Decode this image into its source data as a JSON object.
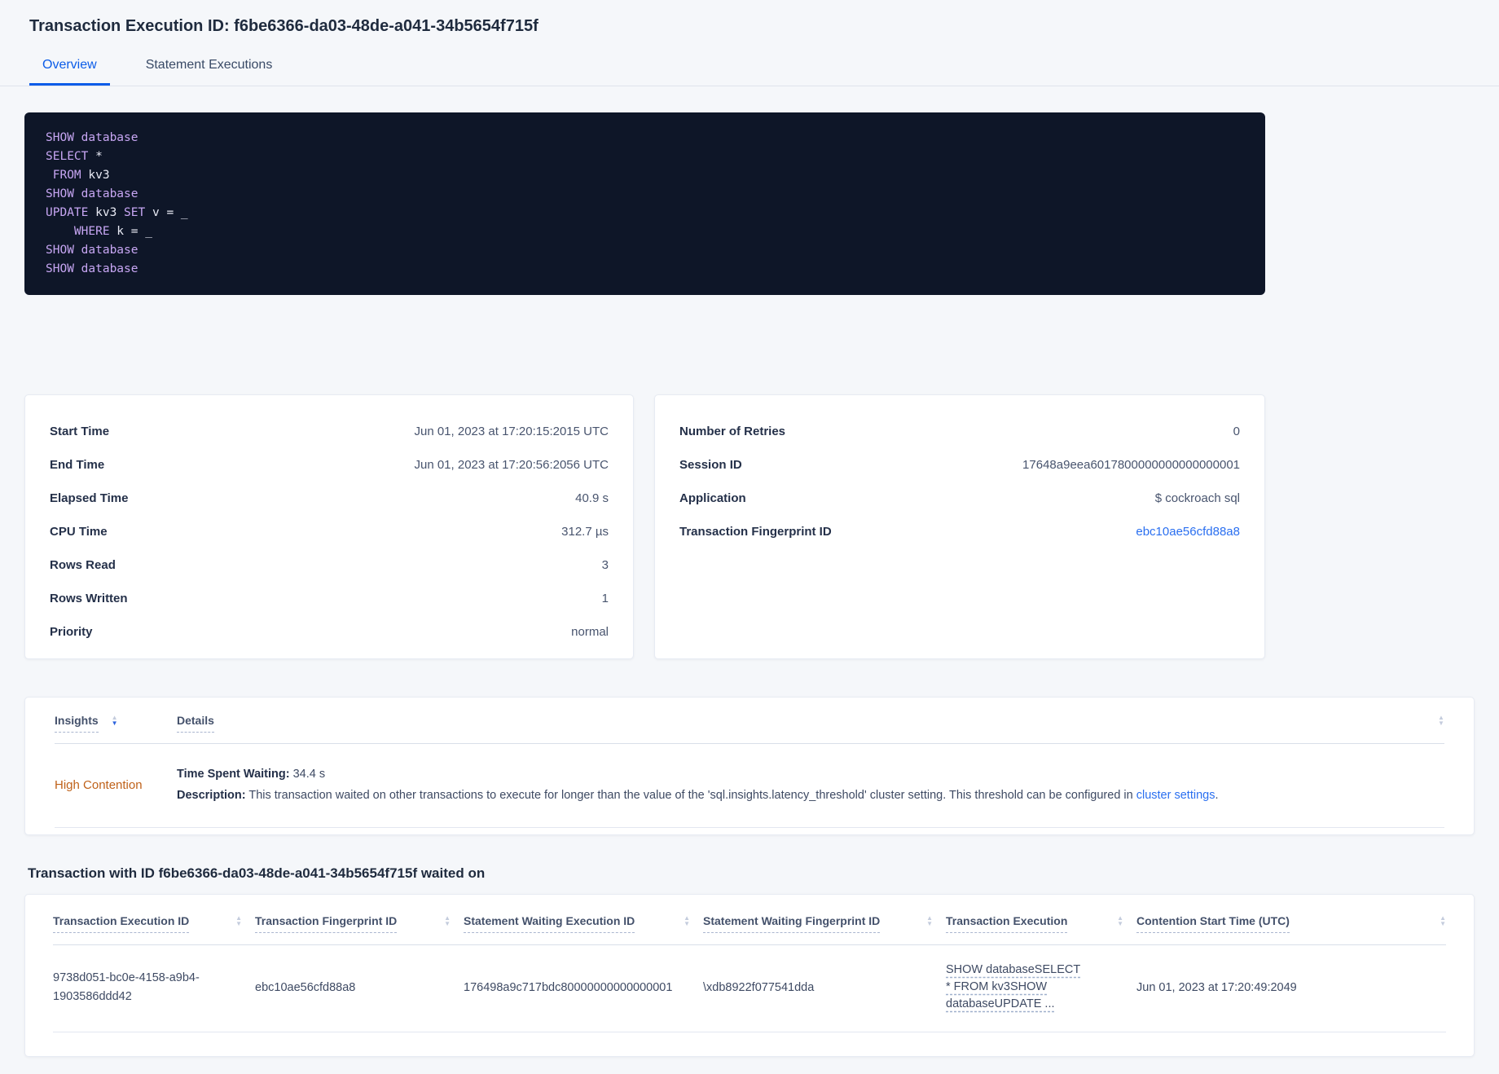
{
  "colors": {
    "accent_blue": "#0b5ce8",
    "link_blue": "#2a6ff0",
    "high_contention_orange": "#bf6119",
    "code_background": "#0e1628",
    "code_keyword": "#c7a6f3",
    "code_plain": "#e9ebf5"
  },
  "header": {
    "title": "Transaction Execution ID: f6be6366-da03-48de-a041-34b5654f715f",
    "tabs": [
      {
        "label": "Overview",
        "active": true
      },
      {
        "label": "Statement Executions",
        "active": false
      }
    ]
  },
  "sql_statements": {
    "lines": [
      [
        [
          "kw",
          "SHOW"
        ],
        [
          "pl",
          " "
        ],
        [
          "kw",
          "database"
        ]
      ],
      [
        [
          "kw",
          "SELECT"
        ],
        [
          "pl",
          " *"
        ]
      ],
      [
        [
          "pl",
          " "
        ],
        [
          "kw",
          "FROM"
        ],
        [
          "pl",
          " kv3"
        ]
      ],
      [
        [
          "kw",
          "SHOW"
        ],
        [
          "pl",
          " "
        ],
        [
          "kw",
          "database"
        ]
      ],
      [
        [
          "kw",
          "UPDATE"
        ],
        [
          "pl",
          " kv3 "
        ],
        [
          "kw",
          "SET"
        ],
        [
          "pl",
          " v = _"
        ]
      ],
      [
        [
          "pl",
          "    "
        ],
        [
          "kw",
          "WHERE"
        ],
        [
          "pl",
          " k = _"
        ]
      ],
      [
        [
          "kw",
          "SHOW"
        ],
        [
          "pl",
          " "
        ],
        [
          "kw",
          "database"
        ]
      ],
      [
        [
          "kw",
          "SHOW"
        ],
        [
          "pl",
          " "
        ],
        [
          "kw",
          "database"
        ]
      ]
    ]
  },
  "details_card_left": {
    "rows": [
      {
        "label": "Start Time",
        "value": "Jun 01, 2023 at 17:20:15:2015 UTC"
      },
      {
        "label": "End Time",
        "value": "Jun 01, 2023 at 17:20:56:2056 UTC"
      },
      {
        "label": "Elapsed Time",
        "value": "40.9 s"
      },
      {
        "label": "CPU Time",
        "value": "312.7 µs"
      },
      {
        "label": "Rows Read",
        "value": "3"
      },
      {
        "label": "Rows Written",
        "value": "1"
      },
      {
        "label": "Priority",
        "value": "normal"
      }
    ]
  },
  "details_card_right": {
    "rows": [
      {
        "label": "Number of Retries",
        "value": "0"
      },
      {
        "label": "Session ID",
        "value": "17648a9eea6017800000000000000001"
      },
      {
        "label": "Application",
        "value": "$ cockroach sql"
      },
      {
        "label": "Transaction Fingerprint ID",
        "value": "ebc10ae56cfd88a8",
        "link": true
      }
    ]
  },
  "insights_table": {
    "columns": [
      {
        "label": "Insights",
        "sorted": "desc"
      },
      {
        "label": "Details",
        "sorted": null
      }
    ],
    "row": {
      "insight": "High Contention",
      "waiting_label": "Time Spent Waiting:",
      "waiting_value": " 34.4 s",
      "description_label": "Description:",
      "description_text": " This transaction waited on other transactions to execute for longer than the value of the 'sql.insights.latency_threshold' cluster setting. This threshold can be configured in ",
      "description_link": "cluster settings",
      "description_suffix": "."
    }
  },
  "waited_on": {
    "heading": "Transaction with ID f6be6366-da03-48de-a041-34b5654f715f waited on",
    "columns": [
      "Transaction Execution ID",
      "Transaction Fingerprint ID",
      "Statement Waiting Execution ID",
      "Statement Waiting Fingerprint ID",
      "Transaction Execution",
      "Contention Start Time (UTC)"
    ],
    "rows": [
      {
        "transaction_execution_id": "9738d051-bc0e-4158-a9b4-1903586ddd42",
        "transaction_fingerprint_id": "ebc10ae56cfd88a8",
        "statement_waiting_execution_id": "176498a9c717bdc80000000000000001",
        "statement_waiting_fingerprint_id": "\\xdb8922f077541dda",
        "transaction_execution": "SHOW databaseSELECT * FROM kv3SHOW databaseUPDATE ...",
        "contention_start_time": "Jun 01, 2023 at 17:20:49:2049"
      }
    ]
  }
}
